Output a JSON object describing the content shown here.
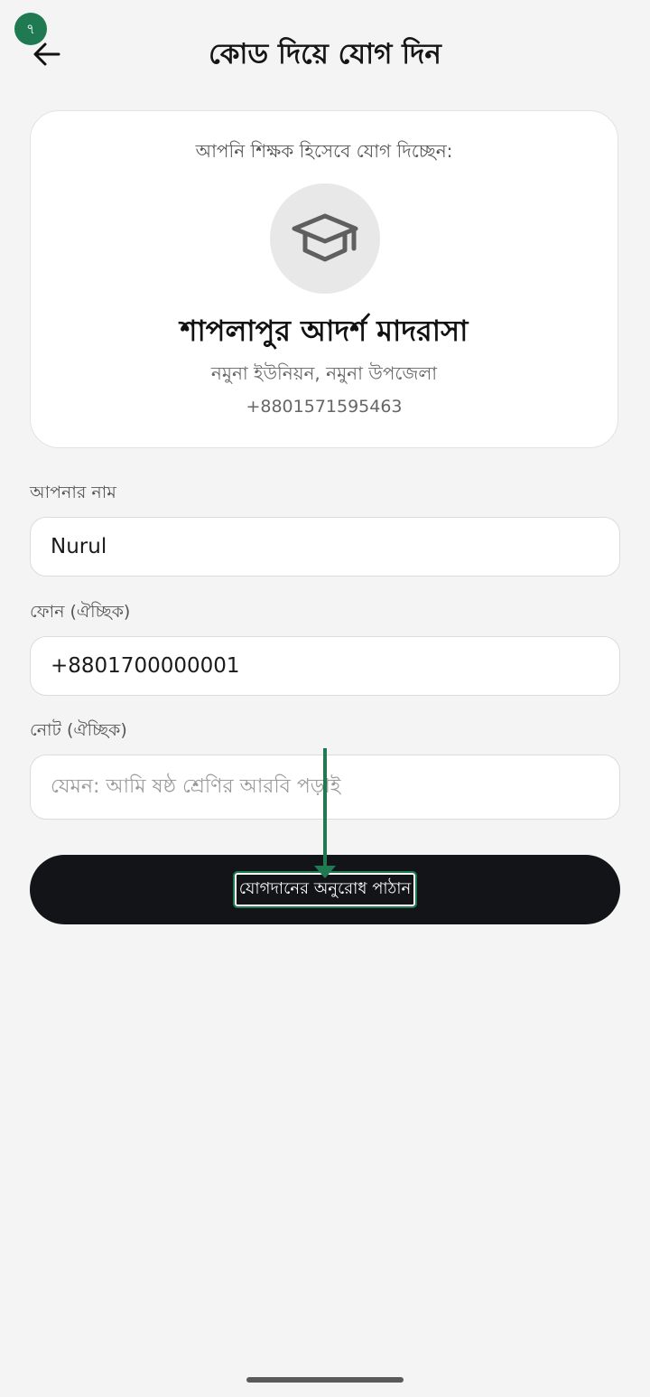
{
  "step_badge": "৭",
  "header": {
    "title": "কোড দিয়ে যোগ দিন"
  },
  "card": {
    "subtitle": "আপনি শিক্ষক হিসেবে যোগ দিচ্ছেন:",
    "avatar_icon": "graduation-cap-icon",
    "school_name": "শাপলাপুর আদর্শ মাদরাসা",
    "address": "নমুনা ইউনিয়ন, নমুনা উপজেলা",
    "phone": "+8801571595463"
  },
  "form": {
    "name_label": "আপনার নাম",
    "name_value": "Nurul",
    "phone_label": "ফোন (ঐচ্ছিক)",
    "phone_value": "+8801700000001",
    "note_label": "নোট (ঐচ্ছিক)",
    "note_placeholder": "যেমন: আমি ষষ্ঠ শ্রেণির আরবি পড়াই"
  },
  "submit_label": "যোগদানের অনুরোধ পাঠান",
  "colors": {
    "accent": "#1f7a52",
    "button": "#121417",
    "background": "#f4f4f4"
  }
}
